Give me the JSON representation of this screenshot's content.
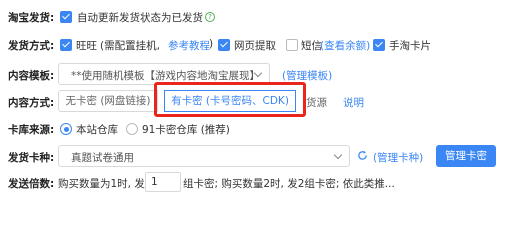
{
  "taobao": {
    "label": "淘宝发货:",
    "auto_update": "自动更新发货状态为已发货",
    "help_icon": "?"
  },
  "method": {
    "label": "发货方式:",
    "wangwang": "旺旺",
    "wangwang_note": "(需配置挂机,",
    "wangwang_link": "参考教程",
    "wangwang_close": ")",
    "web": "网页提取",
    "sms": "短信",
    "sms_link": "(查看余额)",
    "taoka": "手淘卡片"
  },
  "template": {
    "label": "内容模板:",
    "value": "**使用随机模板【游戏内容地淘宝展现】**",
    "manage": "(管理模板)"
  },
  "content": {
    "label": "内容方式:",
    "no_card": "无卡密 (网盘链接)",
    "has_card": "有卡密 (卡号密码、CDK)",
    "source_partial": "货源",
    "explain": "说明"
  },
  "source": {
    "label": "卡库来源:",
    "local": "本站仓库",
    "card91": "91卡密仓库 (推荐)"
  },
  "card_type": {
    "label": "发货卡种:",
    "value": "真题试卷通用",
    "manage_link": "(管理卡种)",
    "manage_btn": "管理卡密"
  },
  "multiple": {
    "label": "发送倍数:",
    "prefix": "购买数量为1时, 发",
    "value": "1",
    "suffix": "组卡密; 购买数量2时, 发2组卡密; 依此类推..."
  }
}
